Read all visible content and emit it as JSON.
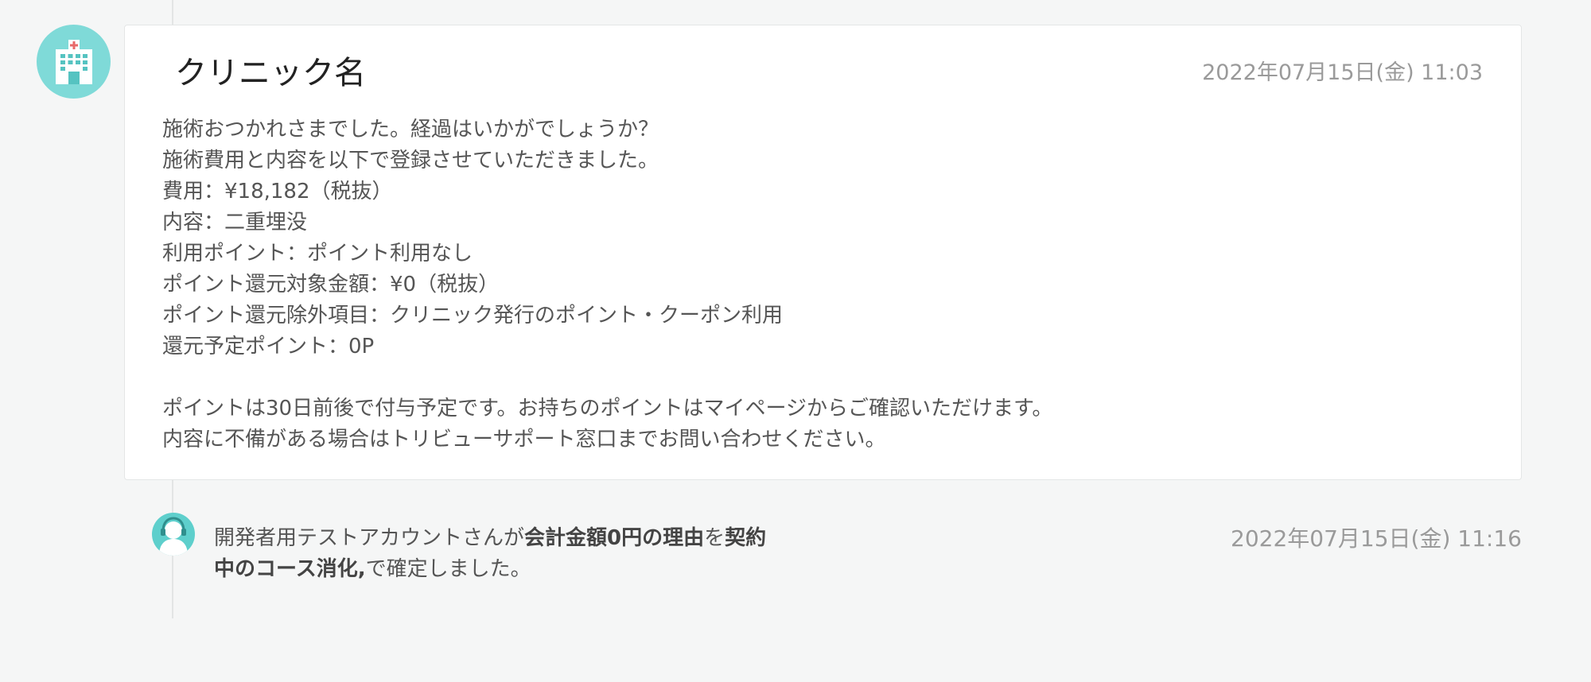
{
  "icons": {
    "clinic_avatar": "hospital-icon",
    "operator_avatar": "support-agent-icon"
  },
  "colors": {
    "background": "#f5f6f6",
    "accent": "#7fdad8",
    "timestamp": "#9a9a9a"
  },
  "clinic_message": {
    "clinic_name": "クリニック名",
    "timestamp": "2022年07月15日(金) 11:03",
    "lines": [
      "施術おつかれさまでした。経過はいかがでしょうか？",
      "施術費用と内容を以下で登録させていただきました。",
      "費用：¥18,182（税抜）",
      "内容：二重埋没",
      "利用ポイント：ポイント利用なし",
      "ポイント還元対象金額：¥0（税抜）",
      "ポイント還元除外項目：クリニック発行のポイント・クーポン利用",
      "還元予定ポイント：0P",
      "",
      "ポイントは30日前後で付与予定です。お持ちのポイントはマイページからご確認いただけます。",
      "内容に不備がある場合はトリビューサポート窓口までお問い合わせください。"
    ]
  },
  "event": {
    "prefix": "開発者用テストアカウントさんが",
    "field": "会計金額0円の理由",
    "middle": "を",
    "value": "契約中のコース消化,",
    "suffix": "で確定しました。",
    "timestamp": "2022年07月15日(金) 11:16"
  }
}
